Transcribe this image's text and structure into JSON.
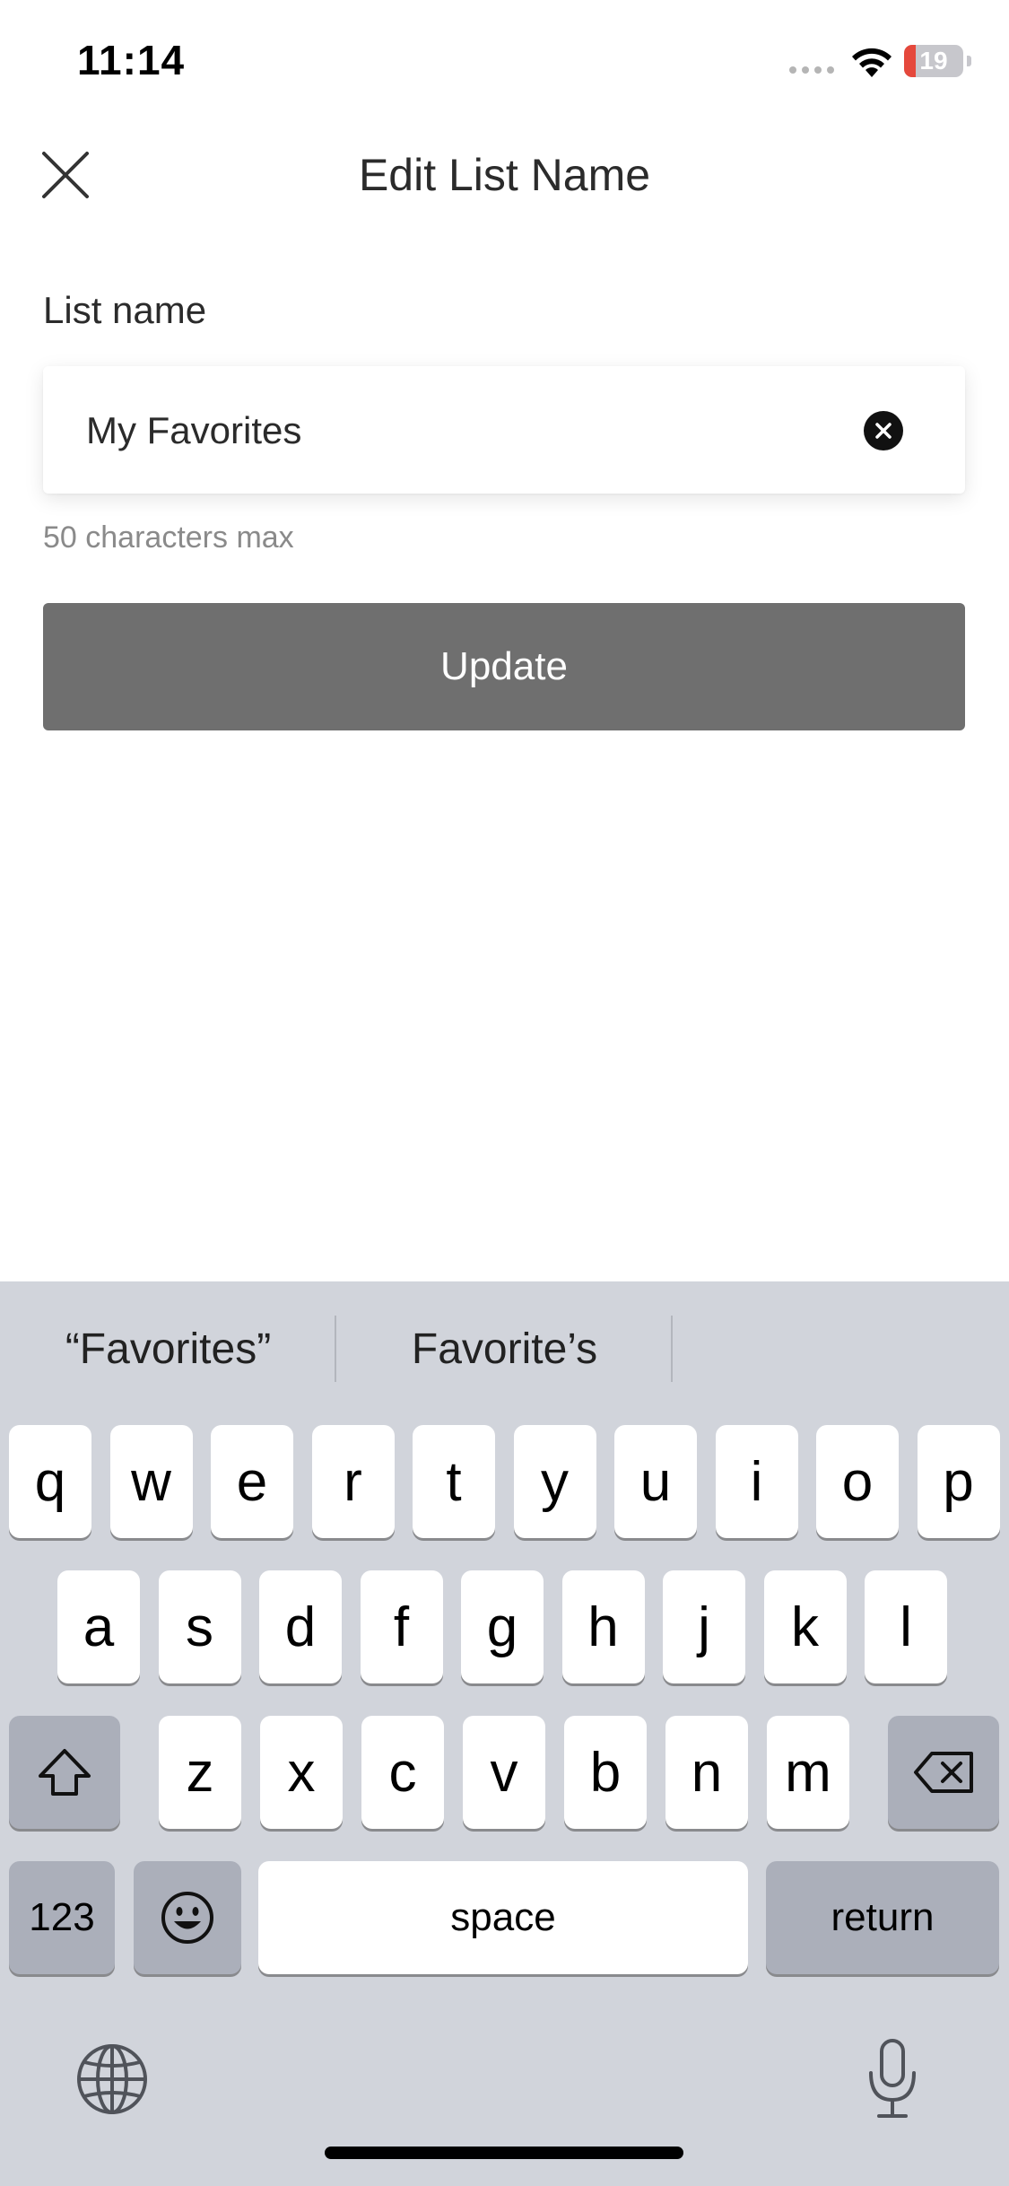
{
  "status_bar": {
    "time": "11:14",
    "battery_percent": "19",
    "battery_level": 0.19,
    "battery_low_color": "#e5483c"
  },
  "header": {
    "title": "Edit List Name",
    "close_icon": "close-icon"
  },
  "form": {
    "label": "List name",
    "value": "My Favorites",
    "helper": "50 characters max",
    "clear_icon": "clear-circle-icon",
    "submit_label": "Update",
    "submit_color": "#6f6f6f"
  },
  "keyboard": {
    "suggestions": [
      "“Favorites”",
      "Favorite’s",
      ""
    ],
    "row1": [
      "q",
      "w",
      "e",
      "r",
      "t",
      "y",
      "u",
      "i",
      "o",
      "p"
    ],
    "row2": [
      "a",
      "s",
      "d",
      "f",
      "g",
      "h",
      "j",
      "k",
      "l"
    ],
    "row3": [
      "z",
      "x",
      "c",
      "v",
      "b",
      "n",
      "m"
    ],
    "numbers_label": "123",
    "space_label": "space",
    "return_label": "return",
    "shift_icon": "shift-icon",
    "delete_icon": "delete-icon",
    "emoji_icon": "emoji-icon",
    "globe_icon": "globe-icon",
    "mic_icon": "microphone-icon"
  }
}
